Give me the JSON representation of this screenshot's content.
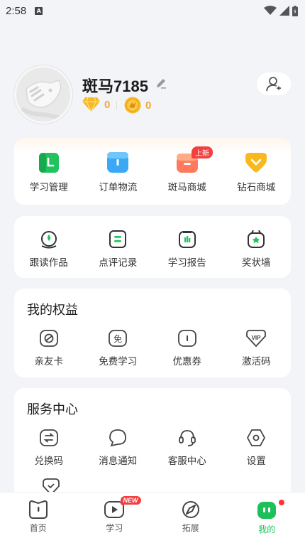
{
  "status_bar": {
    "time": "2:58",
    "notif_letter": "A"
  },
  "profile": {
    "username": "斑马7185",
    "diamonds": "0",
    "coins": "0"
  },
  "orders_section": {
    "items": [
      {
        "label": "学习管理",
        "icon": "study-manage-icon",
        "color": "#22c35e"
      },
      {
        "label": "订单物流",
        "icon": "order-logistics-icon",
        "color": "#3aa8f5"
      },
      {
        "label": "斑马商城",
        "icon": "mall-icon",
        "color": "#ff7a5c",
        "badge": "上新"
      },
      {
        "label": "钻石商城",
        "icon": "diamond-mall-icon",
        "color": "#f9b81d"
      }
    ]
  },
  "reports_section": {
    "items": [
      {
        "label": "跟读作品",
        "icon": "follow-read-icon"
      },
      {
        "label": "点评记录",
        "icon": "review-record-icon"
      },
      {
        "label": "学习报告",
        "icon": "study-report-icon"
      },
      {
        "label": "奖状墙",
        "icon": "award-wall-icon"
      }
    ]
  },
  "rights_section": {
    "title": "我的权益",
    "items": [
      {
        "label": "亲友卡",
        "icon": "friend-card-icon"
      },
      {
        "label": "免费学习",
        "icon": "free-study-icon",
        "glyph": "免"
      },
      {
        "label": "优惠券",
        "icon": "coupon-icon"
      },
      {
        "label": "激活码",
        "icon": "activation-code-icon",
        "glyph": "VIP"
      }
    ]
  },
  "service_section": {
    "title": "服务中心",
    "items": [
      {
        "label": "兑换码",
        "icon": "redeem-code-icon"
      },
      {
        "label": "消息通知",
        "icon": "message-icon"
      },
      {
        "label": "客服中心",
        "icon": "customer-service-icon"
      },
      {
        "label": "设置",
        "icon": "settings-icon"
      }
    ]
  },
  "tabbar": {
    "items": [
      {
        "label": "首页",
        "icon": "home-icon"
      },
      {
        "label": "学习",
        "icon": "study-play-icon",
        "badge": "NEW"
      },
      {
        "label": "拓展",
        "icon": "explore-icon"
      },
      {
        "label": "我的",
        "icon": "my-icon",
        "active": true
      }
    ]
  },
  "colors": {
    "accent": "#1ec05b",
    "gold": "#f2a93b",
    "badge_red": "#f34040"
  }
}
